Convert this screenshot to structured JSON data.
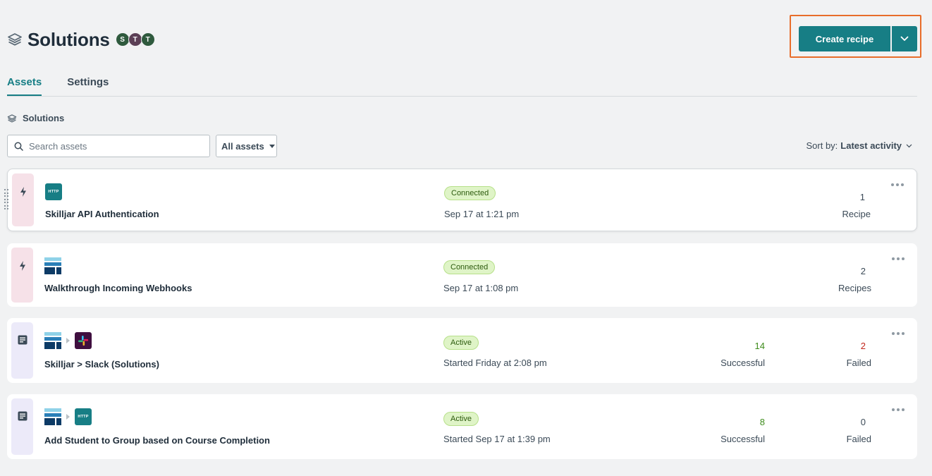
{
  "header": {
    "title": "Solutions",
    "avatars": [
      {
        "letter": "S",
        "color": "#2f5a3d"
      },
      {
        "letter": "T",
        "color": "#5b3f55"
      },
      {
        "letter": "T",
        "color": "#2f5a3d"
      }
    ],
    "create_label": "Create recipe"
  },
  "tabs": [
    {
      "label": "Assets",
      "active": true
    },
    {
      "label": "Settings",
      "active": false
    }
  ],
  "section": {
    "label": "Solutions"
  },
  "search": {
    "placeholder": "Search assets"
  },
  "filter": {
    "label": "All assets"
  },
  "sort": {
    "prefix": "Sort by:",
    "value": "Latest activity"
  },
  "assets": [
    {
      "type": "connection",
      "icons": [
        "http-icon"
      ],
      "name": "Skilljar API Authentication",
      "status": "Connected",
      "date": "Sep 17 at 1:21 pm",
      "count": "1",
      "count_label": "Recipe"
    },
    {
      "type": "connection",
      "icons": [
        "skilljar-icon"
      ],
      "name": "Walkthrough Incoming Webhooks",
      "status": "Connected",
      "date": "Sep 17 at 1:08 pm",
      "count": "2",
      "count_label": "Recipes"
    },
    {
      "type": "recipe",
      "icons": [
        "skilljar-icon",
        "slack-icon"
      ],
      "name": "Skilljar > Slack (Solutions)",
      "status": "Active",
      "date": "Started Friday at 2:08 pm",
      "successful": "14",
      "successful_label": "Successful",
      "failed": "2",
      "failed_label": "Failed"
    },
    {
      "type": "recipe",
      "icons": [
        "skilljar-icon",
        "http-icon"
      ],
      "name": "Add Student to Group based on Course Completion",
      "status": "Active",
      "date": "Started Sep 17 at 1:39 pm",
      "successful": "8",
      "successful_label": "Successful",
      "failed": "0",
      "failed_label": "Failed"
    }
  ],
  "colors": {
    "accent": "#177e85",
    "highlight": "#e86d2a",
    "success": "#3e8c1c",
    "failure": "#c2261c"
  }
}
